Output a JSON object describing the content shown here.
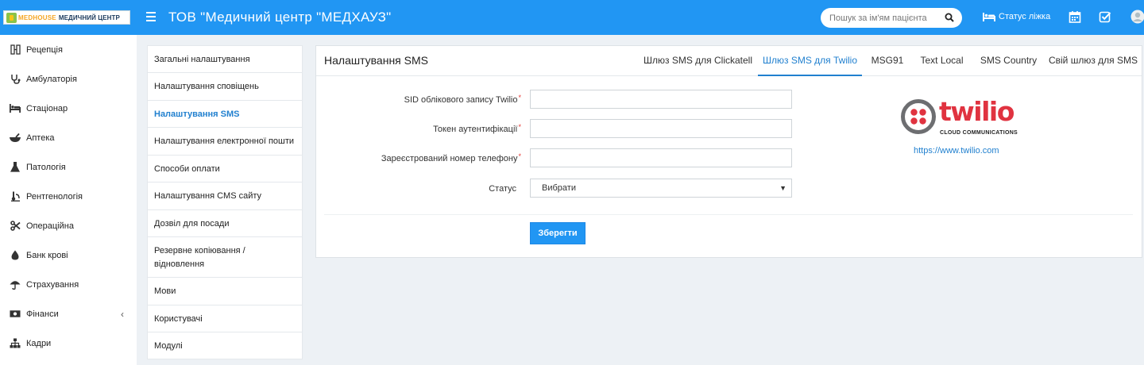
{
  "header": {
    "logo_brand": "MEDHOUSE",
    "logo_name": "МЕДИЧНИЙ ЦЕНТР",
    "title": "ТОВ \"Медичний центр \"МЕДХАУЗ\"",
    "search_placeholder": "Пошук за ім'ям пацієнта",
    "bed_status_label": "Статус ліжка",
    "icons": [
      "menu-icon",
      "search-icon",
      "bed-icon",
      "calendar-icon",
      "checkbox-icon",
      "user-avatar-icon"
    ]
  },
  "sidebar": {
    "items": [
      {
        "label": "Рецепція",
        "icon": "reception-icon"
      },
      {
        "label": "Амбулаторія",
        "icon": "stethoscope-icon"
      },
      {
        "label": "Стаціонар",
        "icon": "bed-icon"
      },
      {
        "label": "Аптека",
        "icon": "mortar-icon"
      },
      {
        "label": "Патологія",
        "icon": "flask-icon"
      },
      {
        "label": "Рентгенологія",
        "icon": "radiology-icon"
      },
      {
        "label": "Операційна",
        "icon": "scissors-icon"
      },
      {
        "label": "Банк крові",
        "icon": "blood-drop-icon"
      },
      {
        "label": "Страхування",
        "icon": "umbrella-icon"
      },
      {
        "label": "Фінанси",
        "icon": "money-icon",
        "chevron": "‹"
      },
      {
        "label": "Кадри",
        "icon": "org-chart-icon"
      }
    ]
  },
  "settings_menu": {
    "items": [
      {
        "label": "Загальні налаштування"
      },
      {
        "label": "Налаштування сповіщень"
      },
      {
        "label": "Налаштування SMS",
        "active": true
      },
      {
        "label": "Налаштування електронної пошти"
      },
      {
        "label": "Способи оплати"
      },
      {
        "label": "Налаштування CMS сайту"
      },
      {
        "label": "Дозвіл для посади"
      },
      {
        "label": "Резервне копіювання / відновлення"
      },
      {
        "label": "Мови"
      },
      {
        "label": "Користувачі"
      },
      {
        "label": "Модулі"
      }
    ]
  },
  "panel": {
    "title": "Налаштування SMS",
    "tabs": [
      {
        "label": "Шлюз SMS для Clickatell"
      },
      {
        "label": "Шлюз SMS для Twilio",
        "active": true
      },
      {
        "label": "MSG91"
      },
      {
        "label": "Text Local"
      },
      {
        "label": "SMS Country"
      },
      {
        "label": "Свій шлюз для SMS"
      }
    ],
    "form": {
      "sid_label": "SID облікового запису Twilio",
      "sid_value": "",
      "token_label": "Токен аутентифікації",
      "token_value": "",
      "phone_label": "Зареєстрований номер телефону",
      "phone_value": "",
      "required_mark": "*",
      "status_label": "Статус",
      "status_value": "Вибрати",
      "save_label": "Зберегти"
    },
    "twilio": {
      "logo_word": "twilio",
      "logo_sub": "CLOUD COMMUNICATIONS",
      "url": "https://www.twilio.com"
    }
  },
  "colors": {
    "topbar": "#2196f3",
    "accent": "#2180cf",
    "twilio_red": "#e03340",
    "background": "#edf1f5"
  }
}
